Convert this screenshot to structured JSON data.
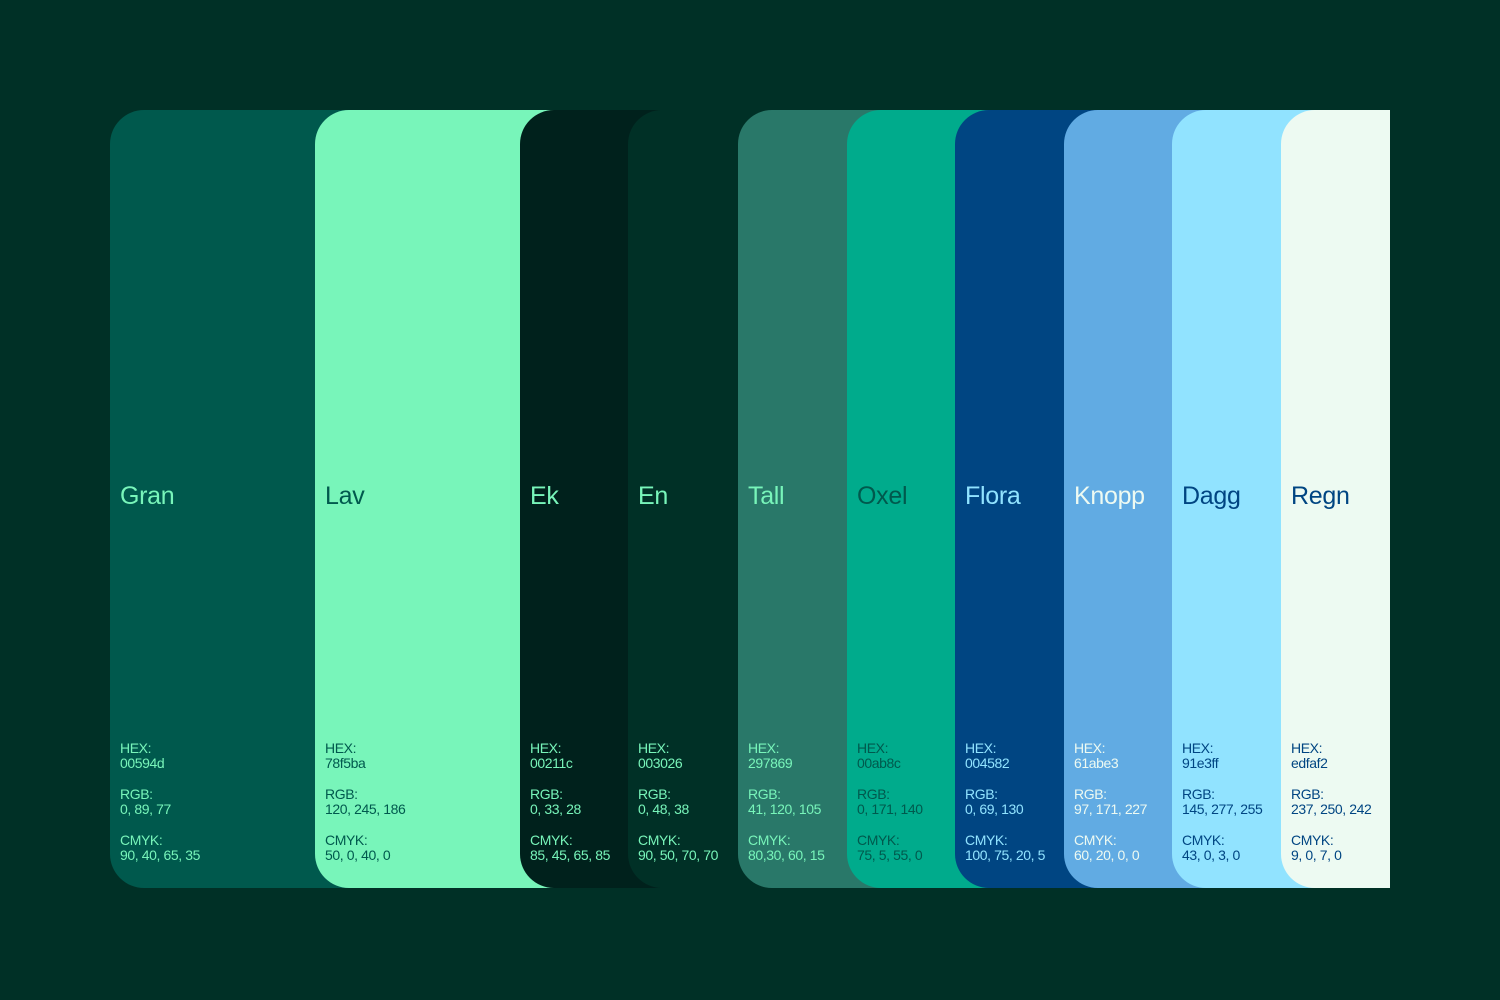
{
  "labels": {
    "hex": "HEX:",
    "rgb": "RGB:",
    "cmyk": "CMYK:"
  },
  "swatches": [
    {
      "name": "Gran",
      "hex": "00594d",
      "rgb": "0, 89, 77",
      "cmyk": "90, 40, 65, 35",
      "color": "#00594d",
      "text_color": "#78f5ba"
    },
    {
      "name": "Lav",
      "hex": "78f5ba",
      "rgb": "120, 245, 186",
      "cmyk": "50, 0, 40, 0",
      "color": "#78f5ba",
      "text_color": "#00594d"
    },
    {
      "name": "Ek",
      "hex": "00211c",
      "rgb": "0, 33, 28",
      "cmyk": "85, 45, 65, 85",
      "color": "#00211c",
      "text_color": "#78f5ba"
    },
    {
      "name": "En",
      "hex": "003026",
      "rgb": "0, 48, 38",
      "cmyk": "90, 50, 70, 70",
      "color": "#003026",
      "text_color": "#78f5ba"
    },
    {
      "name": "Tall",
      "hex": "297869",
      "rgb": "41, 120, 105",
      "cmyk": "80,30, 60, 15",
      "color": "#297869",
      "text_color": "#78f5ba"
    },
    {
      "name": "Oxel",
      "hex": "00ab8c",
      "rgb": "0, 171, 140",
      "cmyk": "75, 5, 55, 0",
      "color": "#00ab8c",
      "text_color": "#00594d"
    },
    {
      "name": "Flora",
      "hex": "004582",
      "rgb": "0, 69, 130",
      "cmyk": "100, 75, 20, 5",
      "color": "#004582",
      "text_color": "#91e3ff"
    },
    {
      "name": "Knopp",
      "hex": "61abe3",
      "rgb": "97, 171, 227",
      "cmyk": "60, 20, 0, 0",
      "color": "#61abe3",
      "text_color": "#edfaf2"
    },
    {
      "name": "Dagg",
      "hex": "91e3ff",
      "rgb": "145, 277, 255",
      "cmyk": "43, 0, 3, 0",
      "color": "#91e3ff",
      "text_color": "#004582"
    },
    {
      "name": "Regn",
      "hex": "edfaf2",
      "rgb": "237, 250, 242",
      "cmyk": "9, 0, 7, 0",
      "color": "#edfaf2",
      "text_color": "#004582"
    }
  ]
}
